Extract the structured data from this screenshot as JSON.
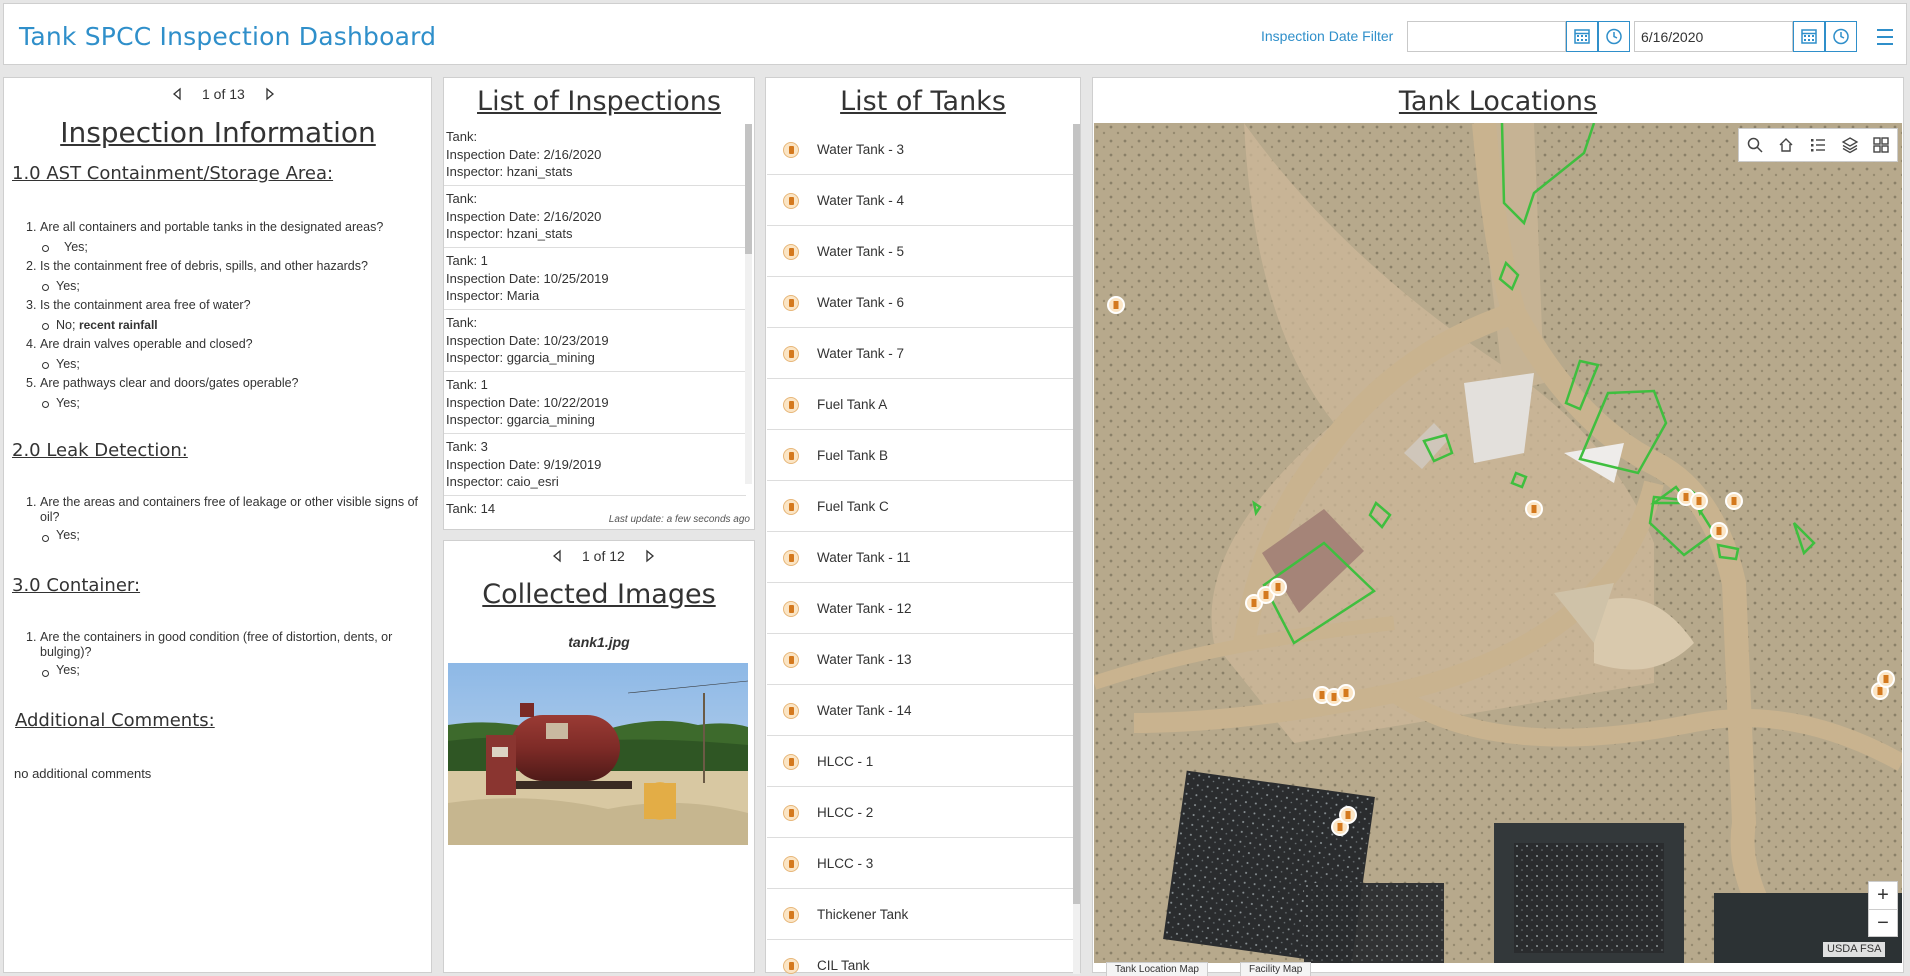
{
  "header": {
    "title": "Tank SPCC Inspection Dashboard",
    "filter_label": "Inspection Date Filter",
    "start_date": "",
    "end_date": "6/16/2020"
  },
  "inspection_info": {
    "pager": "1 of 13",
    "title": "Inspection Information",
    "sections": [
      {
        "title": "1.0 AST Containment/Storage Area:",
        "questions": [
          {
            "num": "1.",
            "text": "Are all containers and portable tanks in the designated areas?",
            "answer": "Yes;",
            "note": ""
          },
          {
            "num": "2.",
            "text": "Is the containment free of debris, spills, and other hazards?",
            "answer": "Yes;",
            "note": ""
          },
          {
            "num": "3.",
            "text": "Is the containment area free of water?",
            "answer": "No;",
            "note": "recent rainfall"
          },
          {
            "num": "4.",
            "text": "Are drain valves operable and closed?",
            "answer": "Yes;",
            "note": ""
          },
          {
            "num": "5.",
            "text": "Are pathways clear and doors/gates operable?",
            "answer": "Yes;",
            "note": ""
          }
        ]
      },
      {
        "title": "2.0 Leak Detection:",
        "questions": [
          {
            "num": "1.",
            "text": "Are the areas and containers free of leakage or other visible signs of oil?",
            "answer": "Yes;",
            "note": ""
          }
        ]
      },
      {
        "title": "3.0 Container:",
        "questions": [
          {
            "num": "1.",
            "text": "Are the containers in good condition (free of distortion, dents, or bulging)?",
            "answer": "Yes;",
            "note": ""
          }
        ]
      }
    ],
    "comments_title": "Additional Comments:",
    "comments_text": "no additional comments"
  },
  "inspections": {
    "title": "List of Inspections",
    "items": [
      {
        "tank": "Tank:",
        "date": "Inspection Date: 2/16/2020",
        "inspector": "Inspector: hzani_stats"
      },
      {
        "tank": "Tank:",
        "date": "Inspection Date: 2/16/2020",
        "inspector": "Inspector: hzani_stats"
      },
      {
        "tank": "Tank: 1",
        "date": "Inspection Date: 10/25/2019",
        "inspector": "Inspector: Maria"
      },
      {
        "tank": "Tank:",
        "date": "Inspection Date: 10/23/2019",
        "inspector": "Inspector: ggarcia_mining"
      },
      {
        "tank": "Tank: 1",
        "date": "Inspection Date: 10/22/2019",
        "inspector": "Inspector: ggarcia_mining"
      },
      {
        "tank": "Tank: 3",
        "date": "Inspection Date: 9/19/2019",
        "inspector": "Inspector: caio_esri"
      },
      {
        "tank": "Tank: 14",
        "date": "",
        "inspector": ""
      }
    ],
    "last_update": "Last update: a few seconds ago"
  },
  "images": {
    "pager": "1 of 12",
    "title": "Collected Images",
    "filename": "tank1.jpg"
  },
  "tanks": {
    "title": "List of Tanks",
    "items": [
      "Water Tank - 3",
      "Water Tank - 4",
      "Water Tank - 5",
      "Water Tank - 6",
      "Water Tank - 7",
      "Fuel Tank A",
      "Fuel Tank B",
      "Fuel Tank C",
      "Water Tank - 11",
      "Water Tank - 12",
      "Water Tank - 13",
      "Water Tank - 14",
      "HLCC - 1",
      "HLCC - 2",
      "HLCC - 3",
      "Thickener Tank",
      "CIL Tank"
    ]
  },
  "map": {
    "title": "Tank Locations",
    "attribution": "USDA FSA",
    "zoom_in": "+",
    "zoom_out": "−",
    "tabs": [
      "Tank Location Map",
      "Facility Map"
    ],
    "tools": [
      "search-icon",
      "home-icon",
      "legend-icon",
      "layers-icon",
      "basemap-icon"
    ]
  },
  "colors": {
    "accent": "#2f8fca",
    "feature_outline": "#3cb93c",
    "tank_icon": "#d4791e"
  }
}
